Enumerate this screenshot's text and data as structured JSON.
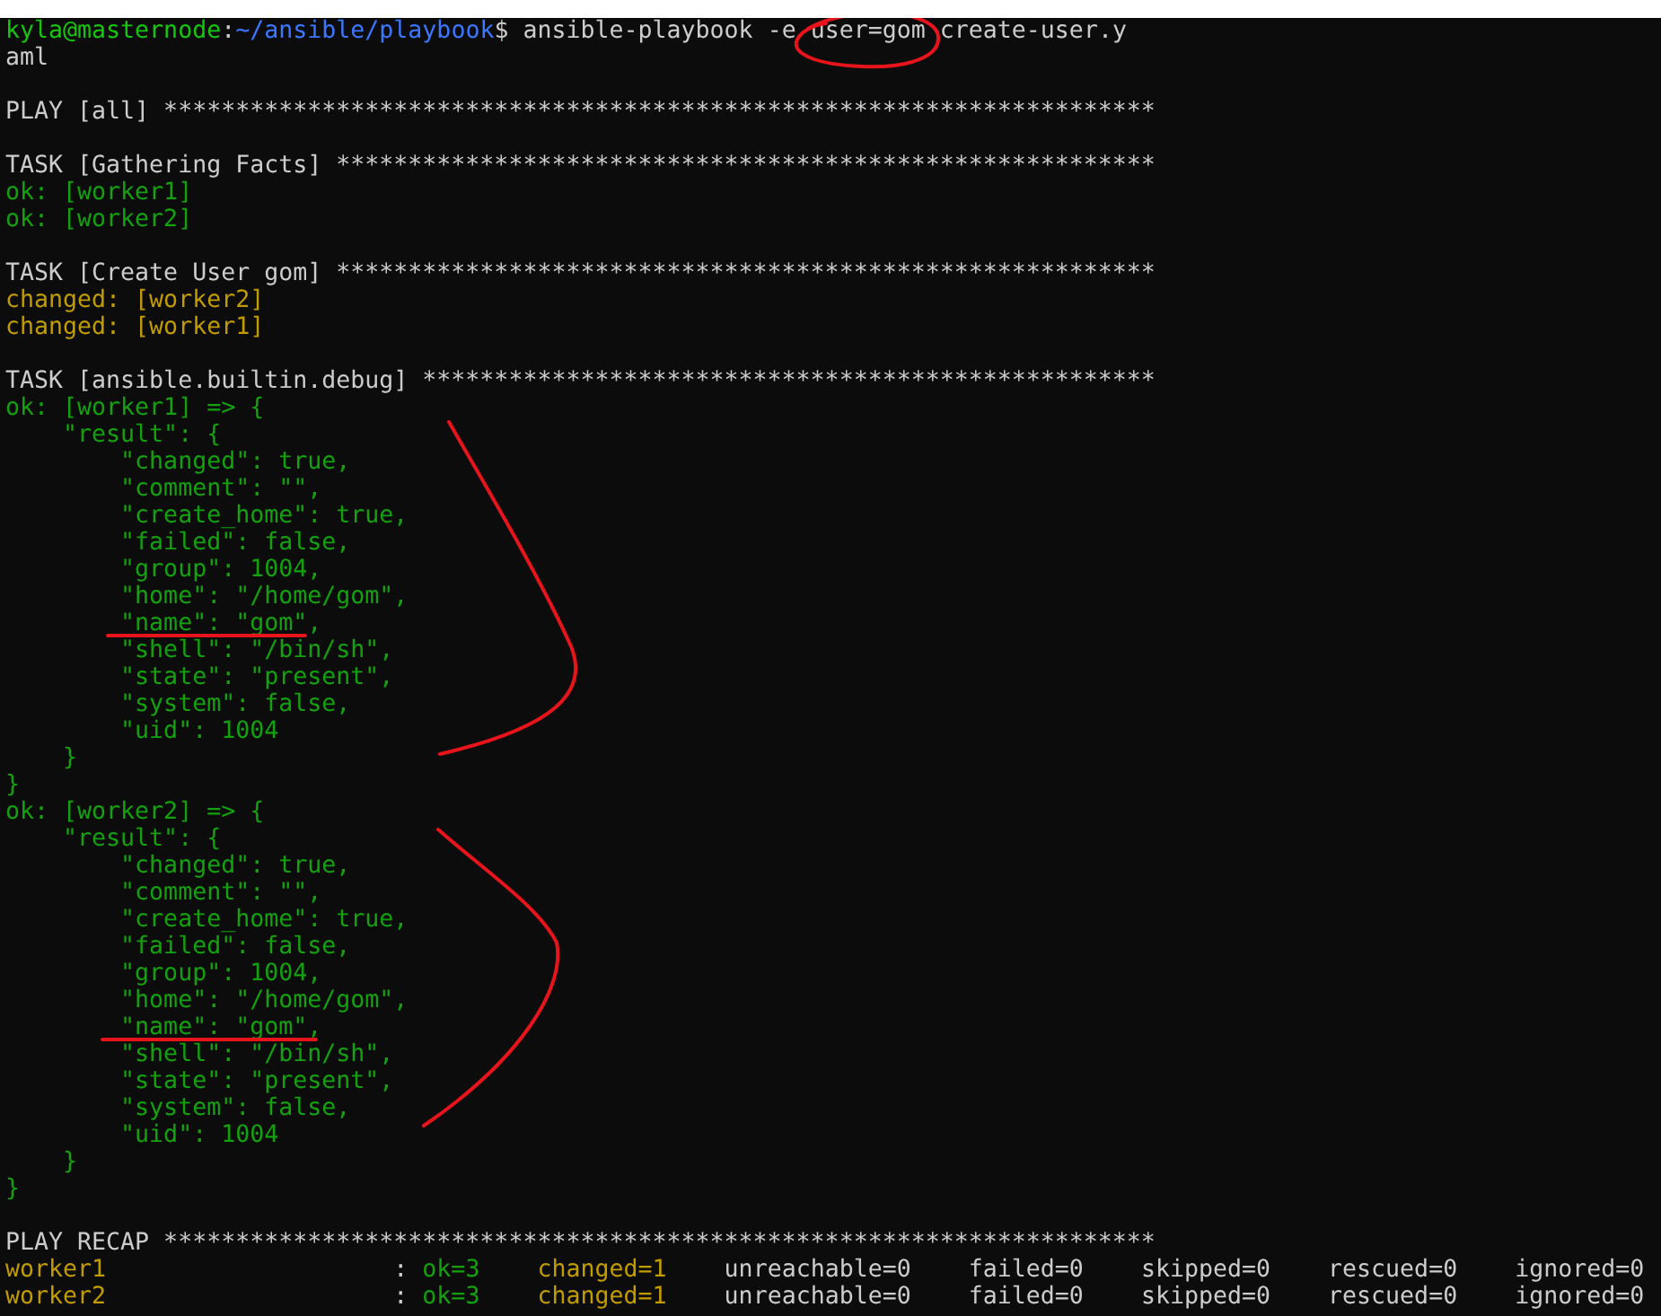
{
  "terminal": {
    "lines": [
      {
        "kind": "output",
        "segments": [
          {
            "kind": "user",
            "text": "kyla@masternode"
          },
          {
            "kind": "text",
            "text": ":"
          },
          {
            "kind": "path",
            "text": "~/ansible/playbook"
          },
          {
            "kind": "text",
            "text": "$ ansible-playbook -e user=gom create-user.y"
          }
        ]
      },
      {
        "kind": "output",
        "segments": [
          {
            "kind": "text",
            "text": "aml"
          }
        ]
      },
      {
        "kind": "blank"
      },
      {
        "kind": "output",
        "segments": [
          {
            "kind": "text",
            "text": "PLAY [all] *********************************************************************"
          }
        ]
      },
      {
        "kind": "blank"
      },
      {
        "kind": "output",
        "segments": [
          {
            "kind": "text",
            "text": "TASK [Gathering Facts] *********************************************************"
          }
        ]
      },
      {
        "kind": "output",
        "segments": [
          {
            "kind": "ok",
            "text": "ok: [worker1]"
          }
        ]
      },
      {
        "kind": "output",
        "segments": [
          {
            "kind": "ok",
            "text": "ok: [worker2]"
          }
        ]
      },
      {
        "kind": "blank"
      },
      {
        "kind": "output",
        "segments": [
          {
            "kind": "text",
            "text": "TASK [Create User gom] *********************************************************"
          }
        ]
      },
      {
        "kind": "output",
        "segments": [
          {
            "kind": "changed",
            "text": "changed: [worker2]"
          }
        ]
      },
      {
        "kind": "output",
        "segments": [
          {
            "kind": "changed",
            "text": "changed: [worker1]"
          }
        ]
      },
      {
        "kind": "blank"
      },
      {
        "kind": "output",
        "segments": [
          {
            "kind": "text",
            "text": "TASK [ansible.builtin.debug] ***************************************************"
          }
        ]
      },
      {
        "kind": "output",
        "segments": [
          {
            "kind": "ok",
            "text": "ok: [worker1] => {"
          }
        ]
      },
      {
        "kind": "output",
        "segments": [
          {
            "kind": "ok",
            "text": "    \"result\": {"
          }
        ]
      },
      {
        "kind": "output",
        "segments": [
          {
            "kind": "ok",
            "text": "        \"changed\": true,"
          }
        ]
      },
      {
        "kind": "output",
        "segments": [
          {
            "kind": "ok",
            "text": "        \"comment\": \"\","
          }
        ]
      },
      {
        "kind": "output",
        "segments": [
          {
            "kind": "ok",
            "text": "        \"create_home\": true,"
          }
        ]
      },
      {
        "kind": "output",
        "segments": [
          {
            "kind": "ok",
            "text": "        \"failed\": false,"
          }
        ]
      },
      {
        "kind": "output",
        "segments": [
          {
            "kind": "ok",
            "text": "        \"group\": 1004,"
          }
        ]
      },
      {
        "kind": "output",
        "segments": [
          {
            "kind": "ok",
            "text": "        \"home\": \"/home/gom\","
          }
        ]
      },
      {
        "kind": "output",
        "segments": [
          {
            "kind": "ok",
            "text": "        \"name\": \"gom\","
          }
        ]
      },
      {
        "kind": "output",
        "segments": [
          {
            "kind": "ok",
            "text": "        \"shell\": \"/bin/sh\","
          }
        ]
      },
      {
        "kind": "output",
        "segments": [
          {
            "kind": "ok",
            "text": "        \"state\": \"present\","
          }
        ]
      },
      {
        "kind": "output",
        "segments": [
          {
            "kind": "ok",
            "text": "        \"system\": false,"
          }
        ]
      },
      {
        "kind": "output",
        "segments": [
          {
            "kind": "ok",
            "text": "        \"uid\": 1004"
          }
        ]
      },
      {
        "kind": "output",
        "segments": [
          {
            "kind": "ok",
            "text": "    }"
          }
        ]
      },
      {
        "kind": "output",
        "segments": [
          {
            "kind": "ok",
            "text": "}"
          }
        ]
      },
      {
        "kind": "output",
        "segments": [
          {
            "kind": "ok",
            "text": "ok: [worker2] => {"
          }
        ]
      },
      {
        "kind": "output",
        "segments": [
          {
            "kind": "ok",
            "text": "    \"result\": {"
          }
        ]
      },
      {
        "kind": "output",
        "segments": [
          {
            "kind": "ok",
            "text": "        \"changed\": true,"
          }
        ]
      },
      {
        "kind": "output",
        "segments": [
          {
            "kind": "ok",
            "text": "        \"comment\": \"\","
          }
        ]
      },
      {
        "kind": "output",
        "segments": [
          {
            "kind": "ok",
            "text": "        \"create_home\": true,"
          }
        ]
      },
      {
        "kind": "output",
        "segments": [
          {
            "kind": "ok",
            "text": "        \"failed\": false,"
          }
        ]
      },
      {
        "kind": "output",
        "segments": [
          {
            "kind": "ok",
            "text": "        \"group\": 1004,"
          }
        ]
      },
      {
        "kind": "output",
        "segments": [
          {
            "kind": "ok",
            "text": "        \"home\": \"/home/gom\","
          }
        ]
      },
      {
        "kind": "output",
        "segments": [
          {
            "kind": "ok",
            "text": "        \"name\": \"gom\","
          }
        ]
      },
      {
        "kind": "output",
        "segments": [
          {
            "kind": "ok",
            "text": "        \"shell\": \"/bin/sh\","
          }
        ]
      },
      {
        "kind": "output",
        "segments": [
          {
            "kind": "ok",
            "text": "        \"state\": \"present\","
          }
        ]
      },
      {
        "kind": "output",
        "segments": [
          {
            "kind": "ok",
            "text": "        \"system\": false,"
          }
        ]
      },
      {
        "kind": "output",
        "segments": [
          {
            "kind": "ok",
            "text": "        \"uid\": 1004"
          }
        ]
      },
      {
        "kind": "output",
        "segments": [
          {
            "kind": "ok",
            "text": "    }"
          }
        ]
      },
      {
        "kind": "output",
        "segments": [
          {
            "kind": "ok",
            "text": "}"
          }
        ]
      },
      {
        "kind": "blank"
      },
      {
        "kind": "output",
        "segments": [
          {
            "kind": "text",
            "text": "PLAY RECAP *********************************************************************"
          }
        ]
      },
      {
        "kind": "output",
        "segments": [
          {
            "kind": "changed",
            "text": "worker1"
          },
          {
            "kind": "text",
            "text": "                    : "
          },
          {
            "kind": "ok",
            "text": "ok=3"
          },
          {
            "kind": "gap"
          },
          {
            "kind": "changed",
            "text": "changed=1"
          },
          {
            "kind": "text",
            "text": "    unreachable=0    failed=0    skipped=0    rescued=0    ignored=0"
          }
        ]
      },
      {
        "kind": "output",
        "segments": [
          {
            "kind": "changed",
            "text": "worker2"
          },
          {
            "kind": "text",
            "text": "                    : "
          },
          {
            "kind": "ok",
            "text": "ok=3"
          },
          {
            "kind": "gap"
          },
          {
            "kind": "changed",
            "text": "changed=1"
          },
          {
            "kind": "text",
            "text": "    unreachable=0    failed=0    skipped=0    rescued=0    ignored=0"
          }
        ]
      }
    ]
  }
}
